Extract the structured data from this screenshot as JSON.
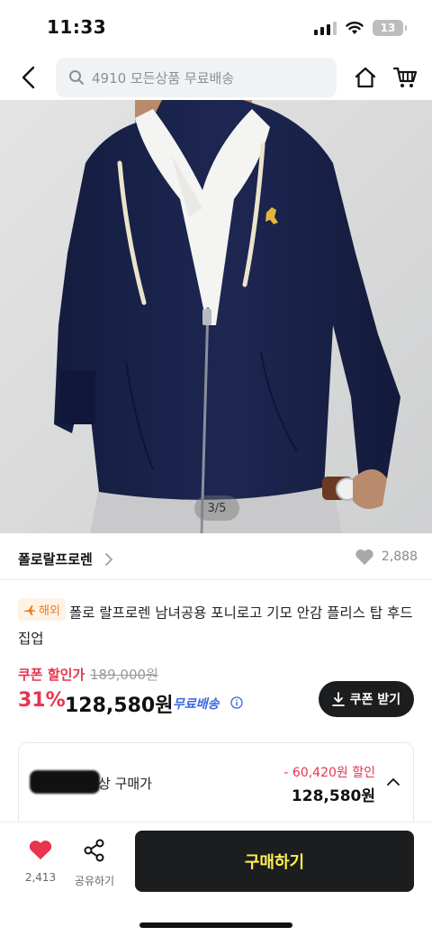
{
  "status": {
    "time": "11:33",
    "battery": "13"
  },
  "search": {
    "placeholder": "4910 모든상품 무료배송"
  },
  "gallery": {
    "counter": "3/5"
  },
  "brand": {
    "name": "폴로랄프로렌",
    "likes": "2,888"
  },
  "product": {
    "badge": "해외",
    "title": "폴로 랄프로렌 남녀공용 포니로고 기모 안감 플리스 탑 후드 집업"
  },
  "price": {
    "coupon_label": "쿠폰 할인가",
    "original": "189,000원",
    "discount_rate": "31%",
    "sale": "128,580원",
    "shipping": "무료배송",
    "coupon_button": "쿠폰 받기"
  },
  "price_box": {
    "label": "상 구매가",
    "discount": "- 60,420원 할인",
    "final": "128,580원"
  },
  "bottom": {
    "wish_count": "2,413",
    "share_label": "공유하기",
    "buy_label": "구매하기"
  },
  "colors": {
    "accent_red": "#e8344e",
    "shipping_blue": "#3a66e0",
    "button_dark": "#1b1d1f",
    "buy_text": "#fff04f",
    "badge_orange": "#f07a1f"
  },
  "icons": [
    "back-arrow-icon",
    "search-icon",
    "home-icon",
    "cart-icon",
    "heart-icon",
    "share-icon",
    "download-icon",
    "info-icon",
    "chevron-up-icon",
    "chevron-right-icon",
    "plane-icon"
  ]
}
